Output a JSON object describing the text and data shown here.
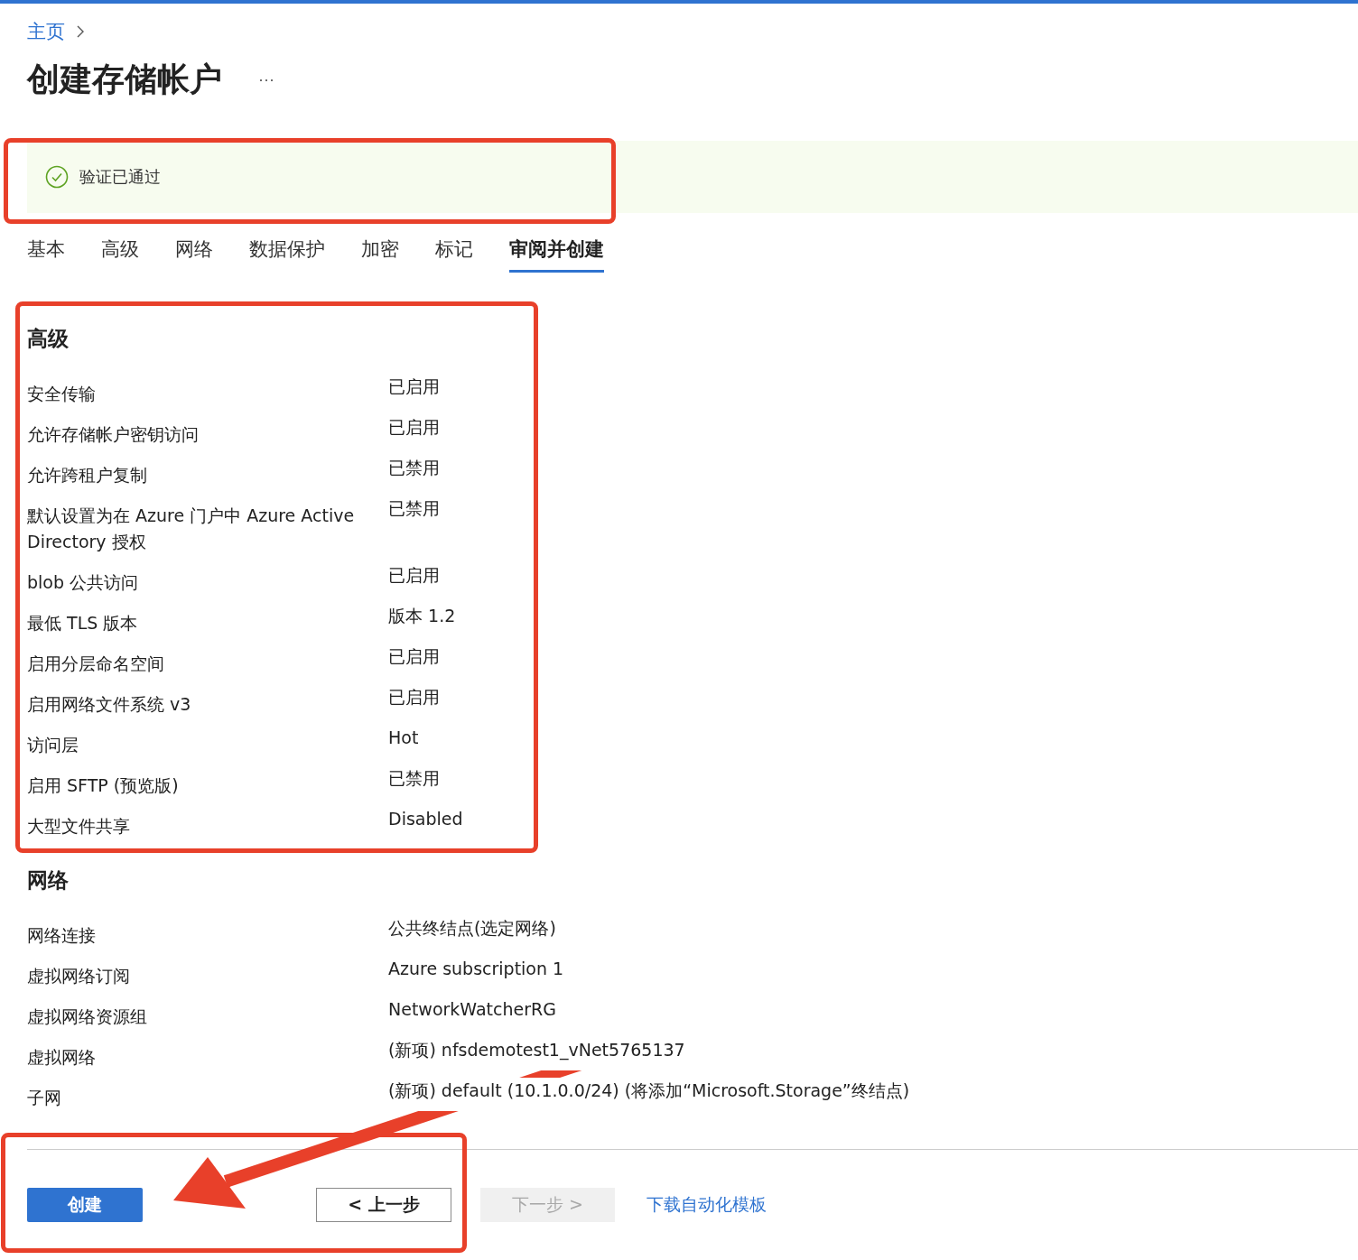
{
  "breadcrumb": [
    {
      "label": "主页"
    }
  ],
  "title": "创建存储帐户",
  "more": "···",
  "banner": {
    "passed": true,
    "highlighted": true,
    "text": "验证已通过"
  },
  "tabs": [
    {
      "label": "基本",
      "selected": false
    },
    {
      "label": "高级",
      "selected": false
    },
    {
      "label": "网络",
      "selected": false
    },
    {
      "label": "数据保护",
      "selected": false
    },
    {
      "label": "加密",
      "selected": false
    },
    {
      "label": "标记",
      "selected": false
    },
    {
      "label": "审阅并创建",
      "selected": true
    }
  ],
  "sections": [
    {
      "heading": "高级",
      "highlighted": true,
      "rows": [
        {
          "label": "安全传输",
          "value": "已启用"
        },
        {
          "label": "允许存储帐户密钥访问",
          "value": "已启用"
        },
        {
          "label": "允许跨租户复制",
          "value": "已禁用"
        },
        {
          "label": "默认设置为在 Azure 门户中 Azure Active Directory 授权",
          "value": "已禁用"
        },
        {
          "label": "blob 公共访问",
          "value": "已启用"
        },
        {
          "label": "最低 TLS 版本",
          "value": "版本 1.2"
        },
        {
          "label": "启用分层命名空间",
          "value": "已启用"
        },
        {
          "label": "启用网络文件系统 v3",
          "value": "已启用"
        },
        {
          "label": "访问层",
          "value": "Hot"
        },
        {
          "label": "启用 SFTP (预览版)",
          "value": "已禁用"
        },
        {
          "label": "大型文件共享",
          "value": "Disabled"
        }
      ]
    },
    {
      "heading": "网络",
      "rows": [
        {
          "label": "网络连接",
          "value": "公共终结点(选定网络)"
        },
        {
          "label": "虚拟网络订阅",
          "value": "Azure subscription 1"
        },
        {
          "label": "虚拟网络资源组",
          "value": "NetworkWatcherRG"
        },
        {
          "label": "虚拟网络",
          "value": "(新项) nfsdemotest1_vNet5765137"
        },
        {
          "label": "子网",
          "value": "(新项) default (10.1.0.0/24) (将添加“Microsoft.Storage”终结点)"
        }
      ]
    }
  ],
  "footer": {
    "highlighted": true,
    "arrow": true,
    "buttons": [
      {
        "label": "创建",
        "kind": "primary",
        "disabled": false
      },
      {
        "label": "< 上一步",
        "kind": "secondary",
        "disabled": false
      },
      {
        "label": "下一步 >",
        "kind": "secondary",
        "disabled": true
      },
      {
        "label": "下载自动化模板",
        "kind": "link",
        "disabled": false
      }
    ]
  }
}
